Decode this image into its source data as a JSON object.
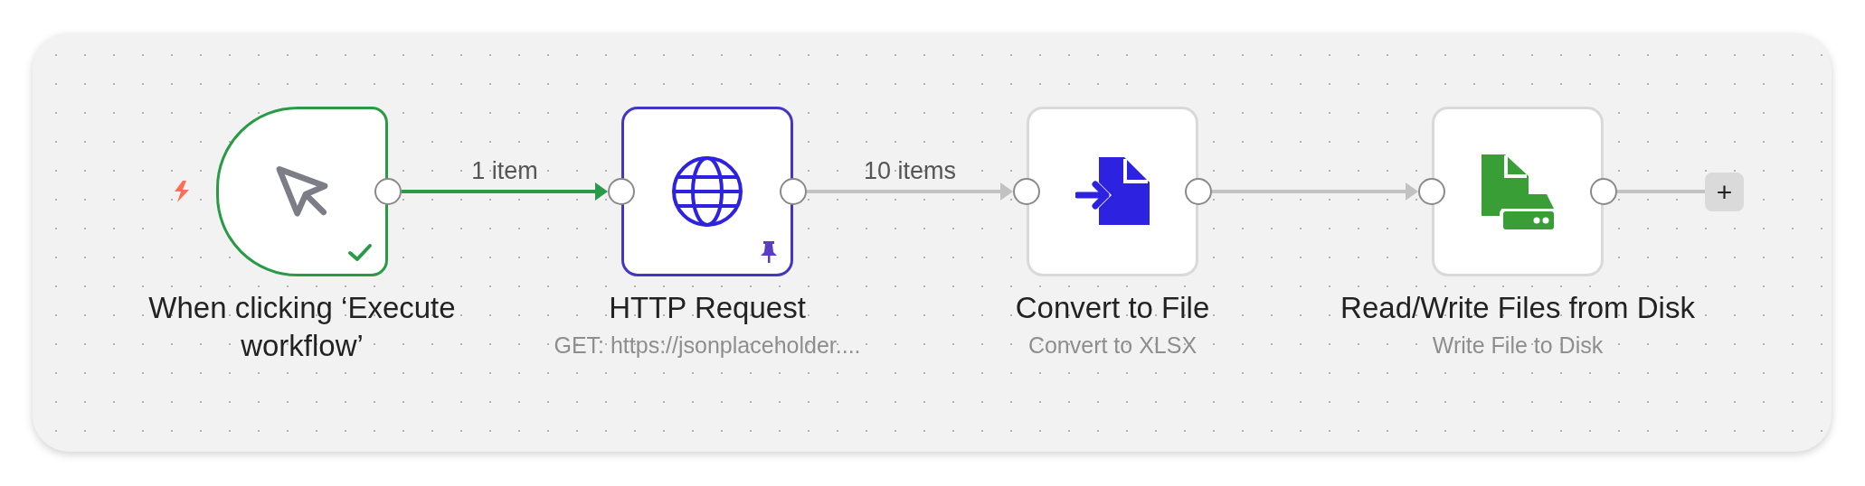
{
  "nodes": [
    {
      "kind": "trigger",
      "succeeded": true,
      "pinned": false,
      "title": "When clicking ‘Execute workflow’"
    },
    {
      "kind": "http",
      "succeeded": false,
      "pinned": true,
      "title": "HTTP Request",
      "subtitle": "GET: https://jsonplaceholder...."
    },
    {
      "kind": "convert",
      "succeeded": false,
      "pinned": false,
      "title": "Convert to File",
      "subtitle": "Convert to XLSX"
    },
    {
      "kind": "files",
      "succeeded": false,
      "pinned": false,
      "title": "Read/Write Files from Disk",
      "subtitle": "Write File to Disk"
    }
  ],
  "connections": [
    {
      "label": "1 item",
      "executed": true
    },
    {
      "label": "10 items",
      "executed": false
    },
    {
      "executed": false
    }
  ],
  "end_button": {
    "label": "+"
  }
}
